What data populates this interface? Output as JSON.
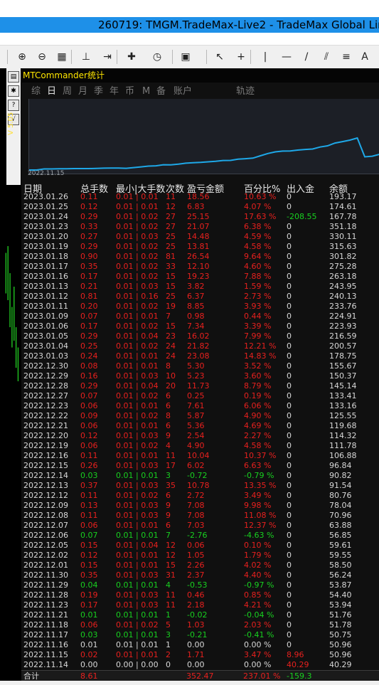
{
  "window": {
    "title": "260719: TMGM.TradeMax-Live2 - TradeMax Global Lin"
  },
  "toolbar": {
    "items": [
      {
        "name": "zoom-in-icon",
        "glyph": "⊕"
      },
      {
        "name": "zoom-out-icon",
        "glyph": "⊖"
      },
      {
        "name": "tile-windows-icon",
        "glyph": "▦"
      },
      {
        "name": "chart-shift-icon",
        "glyph": "⊥"
      },
      {
        "name": "autoscroll-icon",
        "glyph": "⇥"
      },
      {
        "name": "new-order-icon",
        "glyph": "✚"
      },
      {
        "name": "periods-icon",
        "glyph": "◷"
      },
      {
        "name": "templates-icon",
        "glyph": "▣"
      },
      {
        "name": "cursor-icon",
        "glyph": "↖"
      },
      {
        "name": "crosshair-icon",
        "glyph": "+"
      },
      {
        "name": "vertical-line-icon",
        "glyph": "|"
      },
      {
        "name": "horizontal-line-icon",
        "glyph": "—"
      },
      {
        "name": "trendline-icon",
        "glyph": "/"
      },
      {
        "name": "channels-icon",
        "glyph": "⫽"
      },
      {
        "name": "fibonacci-icon",
        "glyph": "≡"
      },
      {
        "name": "text-icon",
        "glyph": "A"
      }
    ]
  },
  "side_panel": {
    "version": "V 5.05",
    "buttons": [
      "▤",
      "✱",
      "?",
      "√"
    ]
  },
  "commander": {
    "title": "MTCommander统计",
    "tabs": [
      "综",
      "日",
      "周",
      "月",
      "季",
      "年",
      "币",
      "M",
      "备",
      "账户",
      "轨迹"
    ],
    "active_tab": "日",
    "equity_start_date": "2022.11.15",
    "equity_curve": [
      40.29,
      40.3,
      50.96,
      50.75,
      51.78,
      51.76,
      53.94,
      54.4,
      53.87,
      56.24,
      58.5,
      59.55,
      59.61,
      56.85,
      63.88,
      70.96,
      78.04,
      80.76,
      91.54,
      90.82,
      96.84,
      106.88,
      111.78,
      114.32,
      119.68,
      125.55,
      133.16,
      133.41,
      145.14,
      150.37,
      155.67,
      178.75,
      200.57,
      216.59,
      223.93,
      224.91,
      233.76,
      240.13,
      243.95,
      263.18,
      275.28,
      301.82,
      315.63,
      330.11,
      351.18,
      167.78,
      174.61,
      193.17
    ]
  },
  "table": {
    "headers": [
      "日期",
      "总手数",
      "最小|大手数",
      "次数",
      "盈亏金额",
      "百分比%",
      "出入金",
      "余额"
    ],
    "rows": [
      [
        "2023.01.26",
        "0.11",
        "0.01 | 0.01",
        "11",
        "18.56",
        "10.63 %",
        "0",
        "193.17"
      ],
      [
        "2023.01.25",
        "0.12",
        "0.01 | 0.01",
        "12",
        "6.83",
        "4.07 %",
        "0",
        "174.61"
      ],
      [
        "2023.01.24",
        "0.29",
        "0.01 | 0.02",
        "27",
        "25.15",
        "17.63 %",
        "-208.55",
        "167.78"
      ],
      [
        "2023.01.23",
        "0.33",
        "0.01 | 0.02",
        "27",
        "21.07",
        "6.38 %",
        "0",
        "351.18"
      ],
      [
        "2023.01.20",
        "0.27",
        "0.01 | 0.03",
        "25",
        "14.48",
        "4.59 %",
        "0",
        "330.11"
      ],
      [
        "2023.01.19",
        "0.29",
        "0.01 | 0.02",
        "25",
        "13.81",
        "4.58 %",
        "0",
        "315.63"
      ],
      [
        "2023.01.18",
        "0.90",
        "0.01 | 0.02",
        "81",
        "26.54",
        "9.64 %",
        "0",
        "301.82"
      ],
      [
        "2023.01.17",
        "0.35",
        "0.01 | 0.02",
        "33",
        "12.10",
        "4.60 %",
        "0",
        "275.28"
      ],
      [
        "2023.01.16",
        "0.17",
        "0.01 | 0.02",
        "15",
        "19.23",
        "7.88 %",
        "0",
        "263.18"
      ],
      [
        "2023.01.13",
        "0.21",
        "0.01 | 0.03",
        "15",
        "3.82",
        "1.59 %",
        "0",
        "243.95"
      ],
      [
        "2023.01.12",
        "0.81",
        "0.01 | 0.16",
        "25",
        "6.37",
        "2.73 %",
        "0",
        "240.13"
      ],
      [
        "2023.01.11",
        "0.20",
        "0.01 | 0.02",
        "19",
        "8.85",
        "3.93 %",
        "0",
        "233.76"
      ],
      [
        "2023.01.09",
        "0.07",
        "0.01 | 0.01",
        "7",
        "0.98",
        "0.44 %",
        "0",
        "224.91"
      ],
      [
        "2023.01.06",
        "0.17",
        "0.01 | 0.02",
        "15",
        "7.34",
        "3.39 %",
        "0",
        "223.93"
      ],
      [
        "2023.01.05",
        "0.29",
        "0.01 | 0.04",
        "23",
        "16.02",
        "7.99 %",
        "0",
        "216.59"
      ],
      [
        "2023.01.04",
        "0.25",
        "0.01 | 0.02",
        "24",
        "21.82",
        "12.21 %",
        "0",
        "200.57"
      ],
      [
        "2023.01.03",
        "0.24",
        "0.01 | 0.01",
        "24",
        "23.08",
        "14.83 %",
        "0",
        "178.75"
      ],
      [
        "2022.12.30",
        "0.08",
        "0.01 | 0.01",
        "8",
        "5.30",
        "3.52 %",
        "0",
        "155.67"
      ],
      [
        "2022.12.29",
        "0.16",
        "0.01 | 0.03",
        "10",
        "5.23",
        "3.60 %",
        "0",
        "150.37"
      ],
      [
        "2022.12.28",
        "0.29",
        "0.01 | 0.04",
        "20",
        "11.73",
        "8.79 %",
        "0",
        "145.14"
      ],
      [
        "2022.12.27",
        "0.07",
        "0.01 | 0.02",
        "6",
        "0.25",
        "0.19 %",
        "0",
        "133.41"
      ],
      [
        "2022.12.23",
        "0.06",
        "0.01 | 0.01",
        "6",
        "7.61",
        "6.06 %",
        "0",
        "133.16"
      ],
      [
        "2022.12.22",
        "0.09",
        "0.01 | 0.02",
        "8",
        "5.87",
        "4.90 %",
        "0",
        "125.55"
      ],
      [
        "2022.12.21",
        "0.06",
        "0.01 | 0.01",
        "6",
        "5.36",
        "4.69 %",
        "0",
        "119.68"
      ],
      [
        "2022.12.20",
        "0.12",
        "0.01 | 0.03",
        "9",
        "2.54",
        "2.27 %",
        "0",
        "114.32"
      ],
      [
        "2022.12.19",
        "0.06",
        "0.01 | 0.02",
        "4",
        "4.90",
        "4.58 %",
        "0",
        "111.78"
      ],
      [
        "2022.12.16",
        "0.11",
        "0.01 | 0.01",
        "11",
        "10.04",
        "10.37 %",
        "0",
        "106.88"
      ],
      [
        "2022.12.15",
        "0.26",
        "0.01 | 0.03",
        "17",
        "6.02",
        "6.63 %",
        "0",
        "96.84"
      ],
      [
        "2022.12.14",
        "0.03",
        "0.01 | 0.01",
        "3",
        "-0.72",
        "-0.79 %",
        "0",
        "90.82"
      ],
      [
        "2022.12.13",
        "0.37",
        "0.01 | 0.03",
        "35",
        "10.78",
        "13.35 %",
        "0",
        "91.54"
      ],
      [
        "2022.12.12",
        "0.11",
        "0.01 | 0.02",
        "6",
        "2.72",
        "3.49 %",
        "0",
        "80.76"
      ],
      [
        "2022.12.09",
        "0.13",
        "0.01 | 0.03",
        "9",
        "7.08",
        "9.98 %",
        "0",
        "78.04"
      ],
      [
        "2022.12.08",
        "0.11",
        "0.01 | 0.03",
        "9",
        "7.08",
        "11.08 %",
        "0",
        "70.96"
      ],
      [
        "2022.12.07",
        "0.06",
        "0.01 | 0.01",
        "6",
        "7.03",
        "12.37 %",
        "0",
        "63.88"
      ],
      [
        "2022.12.06",
        "0.07",
        "0.01 | 0.01",
        "7",
        "-2.76",
        "-4.63 %",
        "0",
        "56.85"
      ],
      [
        "2022.12.05",
        "0.15",
        "0.01 | 0.04",
        "12",
        "0.06",
        "0.10 %",
        "0",
        "59.61"
      ],
      [
        "2022.12.02",
        "0.12",
        "0.01 | 0.01",
        "12",
        "1.05",
        "1.79 %",
        "0",
        "59.55"
      ],
      [
        "2022.12.01",
        "0.15",
        "0.01 | 0.01",
        "15",
        "2.26",
        "4.02 %",
        "0",
        "58.50"
      ],
      [
        "2022.11.30",
        "0.35",
        "0.01 | 0.03",
        "31",
        "2.37",
        "4.40 %",
        "0",
        "56.24"
      ],
      [
        "2022.11.29",
        "0.04",
        "0.01 | 0.01",
        "4",
        "-0.53",
        "-0.97 %",
        "0",
        "53.87"
      ],
      [
        "2022.11.28",
        "0.19",
        "0.01 | 0.03",
        "11",
        "0.46",
        "0.85 %",
        "0",
        "54.40"
      ],
      [
        "2022.11.23",
        "0.17",
        "0.01 | 0.03",
        "11",
        "2.18",
        "4.21 %",
        "0",
        "53.94"
      ],
      [
        "2022.11.21",
        "0.01",
        "0.01 | 0.01",
        "1",
        "-0.02",
        "-0.04 %",
        "0",
        "51.76"
      ],
      [
        "2022.11.18",
        "0.06",
        "0.01 | 0.02",
        "5",
        "1.03",
        "2.03 %",
        "0",
        "51.78"
      ],
      [
        "2022.11.17",
        "0.03",
        "0.01 | 0.01",
        "3",
        "-0.21",
        "-0.41 %",
        "0",
        "50.75"
      ],
      [
        "2022.11.16",
        "0.01",
        "0.01 | 0.01",
        "1",
        "0.00",
        "0.00 %",
        "0",
        "50.96"
      ],
      [
        "2022.11.15",
        "0.02",
        "0.01 | 0.01",
        "2",
        "1.71",
        "3.47 %",
        "8.96",
        "50.96"
      ],
      [
        "2022.11.14",
        "0.00",
        "0.00 | 0.00",
        "0",
        "0.00",
        "0.00 %",
        "40.29",
        "40.29"
      ]
    ],
    "totals": {
      "label": "合计",
      "lots": "8.61",
      "pnl": "352.47",
      "pct": "237.01 %",
      "deposit": "-159.3"
    }
  },
  "colors": {
    "profit": "#e8201e",
    "loss": "#18d020",
    "neutral": "#d8d8d8",
    "header": "#e8e8e8",
    "title_yellow": "#ffe600",
    "equity_line": "#1ea8e8",
    "titlebar": "#1e90e8"
  }
}
